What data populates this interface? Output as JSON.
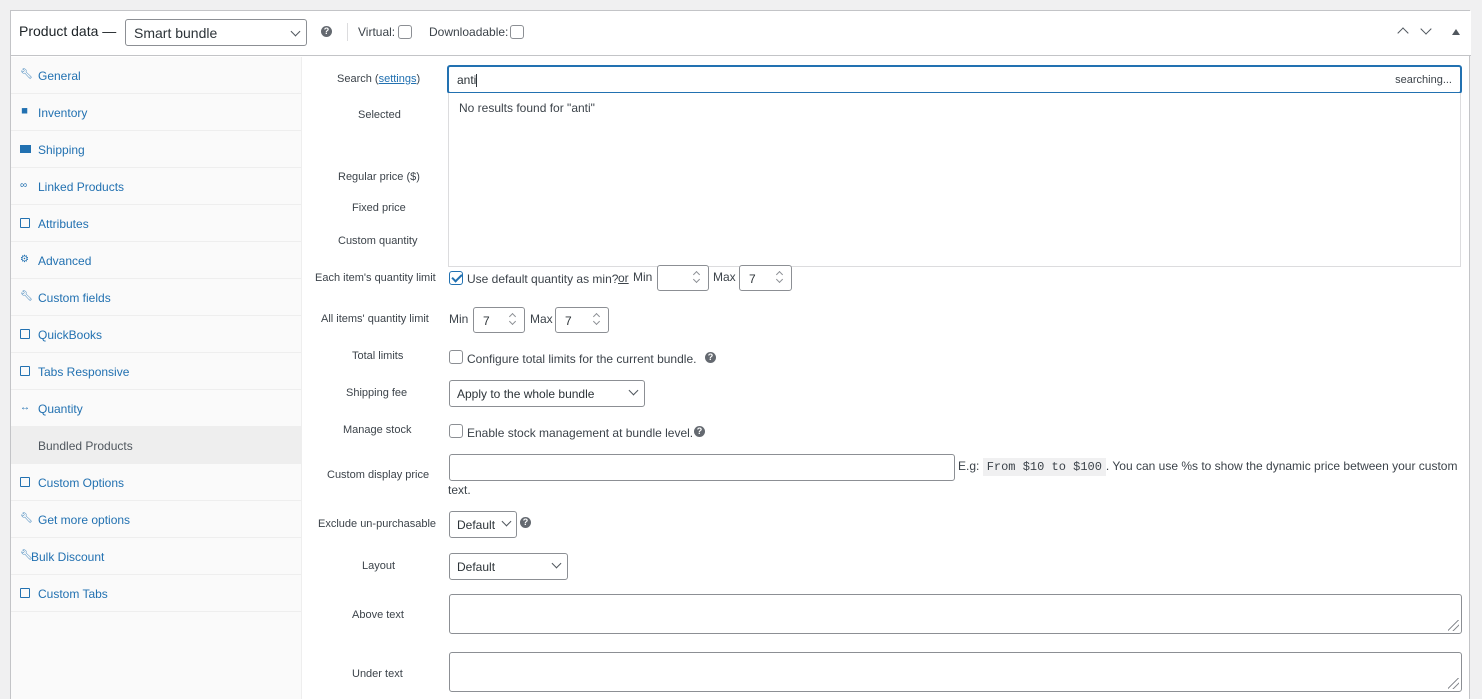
{
  "header": {
    "title": "Product data —",
    "product_type": "Smart bundle",
    "virtual_label": "Virtual:",
    "downloadable_label": "Downloadable:"
  },
  "sidebar": {
    "items": [
      {
        "label": "General",
        "icon": "wrench-icon"
      },
      {
        "label": "Inventory",
        "icon": "tag-icon"
      },
      {
        "label": "Shipping",
        "icon": "truck-icon"
      },
      {
        "label": "Linked Products",
        "icon": "link-icon"
      },
      {
        "label": "Attributes",
        "icon": "table-icon"
      },
      {
        "label": "Advanced",
        "icon": "gear-icon"
      },
      {
        "label": "Custom fields",
        "icon": "wrench-icon"
      },
      {
        "label": "QuickBooks",
        "icon": "book-icon"
      },
      {
        "label": "Tabs Responsive",
        "icon": "list-icon"
      },
      {
        "label": "Quantity",
        "icon": "arrows-icon"
      },
      {
        "label": "Bundled Products",
        "icon": "",
        "active": true
      },
      {
        "label": "Custom Options",
        "icon": "list-icon"
      },
      {
        "label": "Get more options",
        "icon": "wrench-icon"
      },
      {
        "label": "Bulk Discount",
        "icon": "wrench-icon"
      },
      {
        "label": "Custom Tabs",
        "icon": "list-icon"
      }
    ]
  },
  "form": {
    "search_label": "Search (",
    "search_settings": "settings",
    "search_label_end": ")",
    "search_value": "anti",
    "searching_text": "searching...",
    "no_results": "No results found for \"anti\"",
    "selected_label": "Selected",
    "regular_price_label": "Regular price ($)",
    "fixed_price_label": "Fixed price",
    "custom_quantity_label": "Custom quantity",
    "each_item_label": "Each item's quantity limit",
    "use_default_text": "Use default quantity as min?",
    "or_text": "or",
    "min_text": "Min",
    "max_text": "Max",
    "each_max_value": "7",
    "all_items_label": "All items' quantity limit",
    "all_min_value": "7",
    "all_max_value": "7",
    "total_limits_label": "Total limits",
    "total_limits_text": "Configure total limits for the current bundle.",
    "shipping_fee_label": "Shipping fee",
    "shipping_fee_value": "Apply to the whole bundle",
    "manage_stock_label": "Manage stock",
    "manage_stock_text": "Enable stock management at bundle level.",
    "custom_display_label": "Custom display price",
    "eg_text": "E.g:",
    "eg_code": "From $10 to $100",
    "eg_desc": ". You can use %s to show the dynamic price between your custom",
    "eg_desc2": "text.",
    "exclude_label": "Exclude un-purchasable",
    "exclude_value": "Default",
    "layout_label": "Layout",
    "layout_value": "Default",
    "above_text_label": "Above text",
    "under_text_label": "Under text"
  }
}
